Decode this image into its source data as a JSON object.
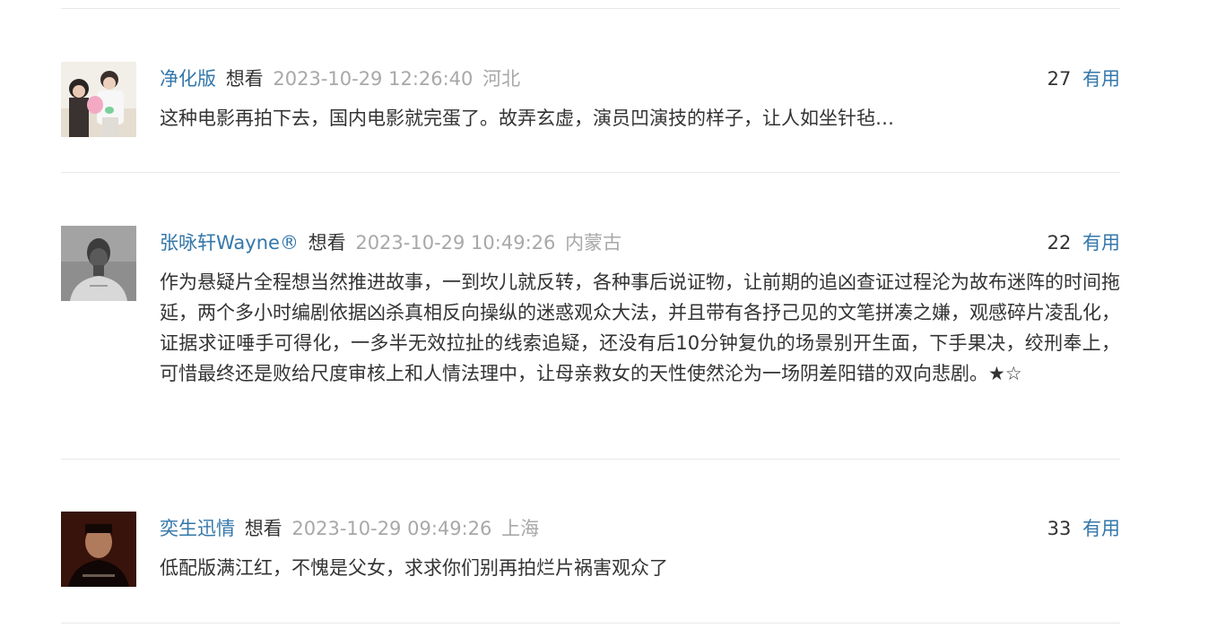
{
  "comments": [
    {
      "username": "净化版",
      "status": "想看",
      "time": "2023-10-29 12:26:40",
      "location": "河北",
      "votes": "27",
      "useful_label": "有用",
      "content": "这种电影再拍下去，国内电影就完蛋了。故弄玄虚，演员凹演技的样子，让人如坐针毡…"
    },
    {
      "username": "张咏轩Wayne®",
      "status": "想看",
      "time": "2023-10-29 10:49:26",
      "location": "内蒙古",
      "votes": "22",
      "useful_label": "有用",
      "content": "作为悬疑片全程想当然推进故事，一到坎儿就反转，各种事后说证物，让前期的追凶查证过程沦为故布迷阵的时间拖延，两个多小时编剧依据凶杀真相反向操纵的迷惑观众大法，并且带有各抒己见的文笔拼凑之嫌，观感碎片凌乱化，证据求证唾手可得化，一多半无效拉扯的线索追疑，还没有后10分钟复仇的场景别开生面，下手果决，绞刑奉上，可惜最终还是败给尺度审核上和人情法理中，让母亲救女的天性使然沦为一场阴差阳错的双向悲剧。★☆"
    },
    {
      "username": "奕生迅情",
      "status": "想看",
      "time": "2023-10-29 09:49:26",
      "location": "上海",
      "votes": "33",
      "useful_label": "有用",
      "content": "低配版满江红，不愧是父女，求求你们别再拍烂片祸害观众了"
    }
  ],
  "colors": {
    "link": "#3377aa",
    "muted": "#a8a8a8",
    "text": "#333333",
    "divider": "#e8e8e8"
  }
}
